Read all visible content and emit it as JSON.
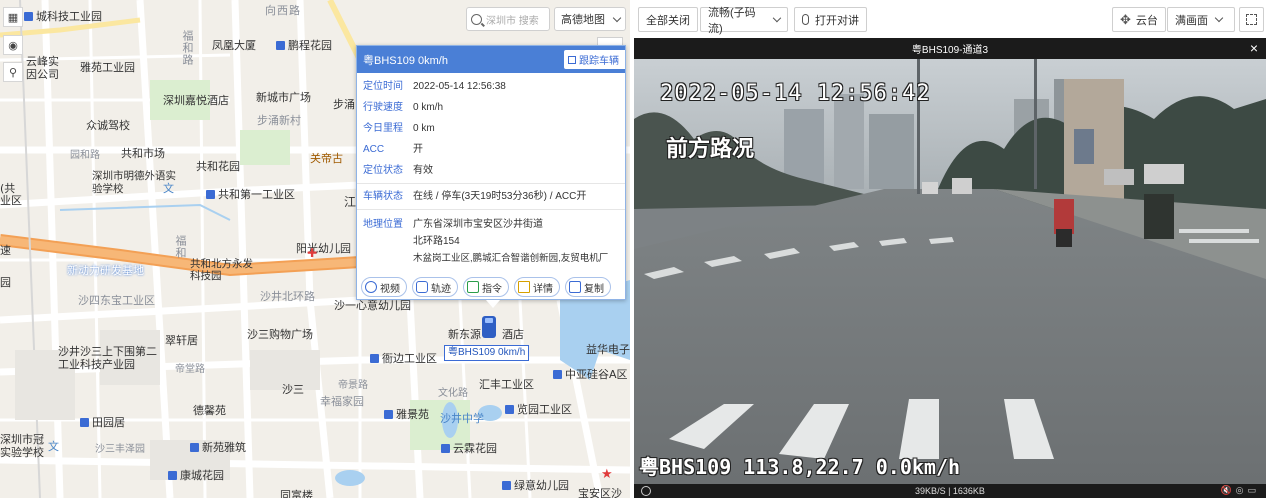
{
  "map": {
    "search_placeholder": "深圳市 搜索",
    "map_type": "高德地图",
    "layer_icon": "layers-icon",
    "eye_icon": "eye-icon",
    "person_icon": "person-pin-icon",
    "zoom_in": "+",
    "zoom_out": "−",
    "labels": [
      {
        "t": "城科技工业园"
      },
      {
        "t": "雅苑工业园"
      },
      {
        "t": "凤凰大厦"
      },
      {
        "t": "鹏程花园"
      },
      {
        "t": "深圳嘉悦酒店"
      },
      {
        "t": "新城市广场"
      },
      {
        "t": "步涌新村"
      },
      {
        "t": "众诚驾校"
      },
      {
        "t": "共和市场"
      },
      {
        "t": "深圳市明德外语实验学校"
      },
      {
        "t": "共和花园"
      },
      {
        "t": "关帝古"
      },
      {
        "t": "共和第一工业区"
      },
      {
        "t": "阳光幼儿园"
      },
      {
        "t": "新动力研发基地"
      },
      {
        "t": "共和北方永发科技园"
      },
      {
        "t": "沙井北环路"
      },
      {
        "t": "沙四东宝工业区"
      },
      {
        "t": "沙一心意幼儿园"
      },
      {
        "t": "翠轩居"
      },
      {
        "t": "沙三购物广场"
      },
      {
        "t": "新东源"
      },
      {
        "t": "酒店"
      },
      {
        "t": "沙井沙三上下围第二工业科技产业园"
      },
      {
        "t": "衙边工业区"
      },
      {
        "t": "益华电子"
      },
      {
        "t": "帝堂路"
      },
      {
        "t": "汇丰工业区"
      },
      {
        "t": "中亚硅谷A区"
      },
      {
        "t": "德馨苑"
      },
      {
        "t": "沙三"
      },
      {
        "t": "幸福家园"
      },
      {
        "t": "雅景苑"
      },
      {
        "t": "沙井中学"
      },
      {
        "t": "览园工业区"
      },
      {
        "t": "田园居"
      },
      {
        "t": "深圳市冠"
      },
      {
        "t": "实验学校"
      },
      {
        "t": "新苑雅筑"
      },
      {
        "t": "沙三丰泽园"
      },
      {
        "t": "云霖花园"
      },
      {
        "t": "康城花园"
      },
      {
        "t": "绿意幼儿园"
      },
      {
        "t": "宝安区沙"
      },
      {
        "t": "同富楼"
      },
      {
        "t": "园和路"
      },
      {
        "t": "宝安"
      },
      {
        "t": "文化路"
      },
      {
        "t": "岗西路"
      },
      {
        "t": "向西路"
      },
      {
        "t": "福和路"
      },
      {
        "t": "福和"
      },
      {
        "t": "步涌"
      },
      {
        "t": "云峰实"
      },
      {
        "t": "因公司"
      },
      {
        "t": "汇丰"
      },
      {
        "t": "步涌"
      },
      {
        "t": "(共"
      },
      {
        "t": "业区"
      },
      {
        "t": "速"
      },
      {
        "t": "园"
      },
      {
        "t": "江"
      },
      {
        "t": "帝景路"
      },
      {
        "t": "国"
      },
      {
        "t": "东"
      },
      {
        "t": "乐"
      },
      {
        "t": "路"
      }
    ],
    "popup": {
      "title": "粤BHS109 0km/h",
      "follow_label": "跟踪车辆",
      "rows": [
        {
          "k": "定位时间",
          "v": "2022-05-14 12:56:38"
        },
        {
          "k": "行驶速度",
          "v": "0 km/h"
        },
        {
          "k": "今日里程",
          "v": "0 km"
        },
        {
          "k": "ACC",
          "v": "开"
        },
        {
          "k": "定位状态",
          "v": "有效"
        }
      ],
      "status_k": "车辆状态",
      "status_v": "在线 / 停车(3天19时53分36秒) / ACC开",
      "addr_k": "地理位置",
      "addr_v1": "广东省深圳市宝安区沙井街道",
      "addr_v2": "北环路154",
      "addr_v3": "木盆岗工业区,鹏城汇合智谐创新园,友贸电机厂",
      "buttons": [
        {
          "label": "视频",
          "icon": "play-circle-icon"
        },
        {
          "label": "轨迹",
          "icon": "track-icon"
        },
        {
          "label": "指令",
          "icon": "command-icon"
        },
        {
          "label": "详情",
          "icon": "list-icon"
        },
        {
          "label": "复制",
          "icon": "copy-icon"
        }
      ]
    },
    "vehicle_tag": "粤BHS109 0km/h"
  },
  "toolbar": {
    "close_all": "全部关闭",
    "stream": "流畅(子码流)",
    "talk": "打开对讲",
    "ptz": "云台",
    "fill": "满画面"
  },
  "video": {
    "title": "粤BHS109-通道3",
    "close": "×",
    "osd_time": "2022-05-14 12:56:42",
    "osd_cam": "前方路况",
    "osd_bottom": "粤BHS109 113.8,22.7 0.0km/h",
    "status": "39KB/S | 1636KB"
  }
}
